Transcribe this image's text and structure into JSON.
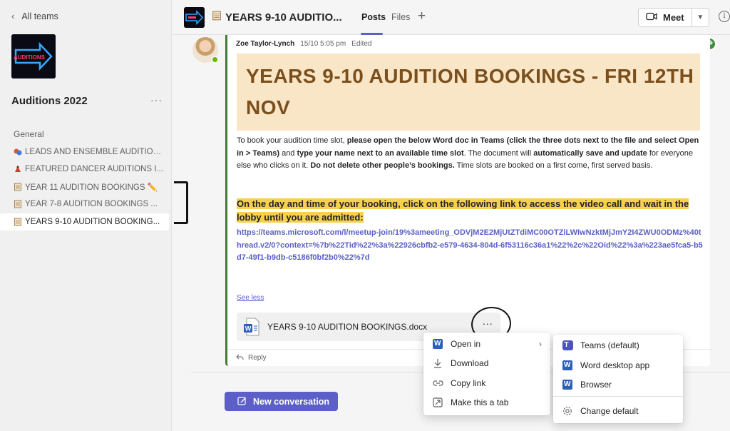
{
  "sidebar": {
    "back_label": "All teams",
    "team_name": "Auditions 2022",
    "team_logo_text": "AUDITIONS",
    "more": "···",
    "channels": [
      {
        "label": "General",
        "icon": "none"
      },
      {
        "label": "LEADS AND ENSEMBLE AUDITION...",
        "icon": "theatre-masks-icon"
      },
      {
        "label": "FEATURED DANCER AUDITIONS I...",
        "icon": "dancer-icon"
      },
      {
        "label": "YEAR 11 AUDITION BOOKINGS ✏️",
        "icon": "notepad-icon"
      },
      {
        "label": "YEAR 7-8 AUDITION BOOKINGS ...",
        "icon": "notepad-icon"
      },
      {
        "label": "YEARS 9-10 AUDITION BOOKING...",
        "icon": "notepad-icon"
      }
    ]
  },
  "header": {
    "title": "YEARS 9-10 AUDITIO...",
    "tabs": [
      {
        "label": "Posts"
      },
      {
        "label": "Files"
      }
    ],
    "add_tab": "+",
    "meet_label": "Meet",
    "info": "i"
  },
  "post": {
    "author": "Zoe Taylor-Lynch",
    "time": "15/10 5:05 pm",
    "edited": "Edited",
    "banner_title": "YEARS 9-10 AUDITION BOOKINGS - FRI 12TH NOV",
    "body_parts": [
      {
        "text": "To book your audition time slot, ",
        "bold": false
      },
      {
        "text": "please open the below Word doc in Teams (click the three dots next to the file and select Open in > Teams)",
        "bold": true
      },
      {
        "text": " and ",
        "bold": false
      },
      {
        "text": "type your name next to an available time slot",
        "bold": true
      },
      {
        "text": ". The document will ",
        "bold": false
      },
      {
        "text": "automatically save and update",
        "bold": true
      },
      {
        "text": " for everyone else who clicks on it. ",
        "bold": false
      },
      {
        "text": "Do not delete other people’s bookings.",
        "bold": true
      },
      {
        "text": " Time slots are booked on a first come, first served basis.",
        "bold": false
      }
    ],
    "highlight": "On the day and time of your booking, click on the following link to access the video call and wait in the lobby until you are admitted:",
    "link": "https://teams.microsoft.com/l/meetup-join/19%3ameeting_ODVjM2E2MjUtZTdiMC00OTZiLWIwNzktMjJmY2I4ZWU0ODMz%40thread.v2/0?context=%7b%22Tid%22%3a%22926cbfb2-e579-4634-804d-6f53116c36a1%22%2c%22Oid%22%3a%223ae5fca5-b5d7-49f1-b9db-c5186f0bf2b0%22%7d",
    "see_less": "See less",
    "attachment": "YEARS 9-10 AUDITION BOOKINGS.docx",
    "more_options": "...",
    "reply": "Reply"
  },
  "compose": {
    "new_conversation": "New conversation"
  },
  "context_menu": {
    "items": [
      {
        "label": "Open in",
        "icon": "word-icon",
        "has_submenu": true
      },
      {
        "label": "Download",
        "icon": "download-icon"
      },
      {
        "label": "Copy link",
        "icon": "link-icon"
      },
      {
        "label": "Make this a tab",
        "icon": "tab-icon"
      }
    ]
  },
  "submenu": {
    "items": [
      {
        "label": "Teams (default)",
        "icon": "teams-icon"
      },
      {
        "label": "Word desktop app",
        "icon": "word-icon"
      },
      {
        "label": "Browser",
        "icon": "word-icon"
      },
      {
        "label": "Change default",
        "icon": "gear-icon"
      }
    ]
  },
  "colors": {
    "accent": "#5b5fc7",
    "banner_bg": "#f9e6c7",
    "banner_text": "#7a4f1c",
    "highlight": "#f5d14d",
    "post_border": "#447a35"
  }
}
